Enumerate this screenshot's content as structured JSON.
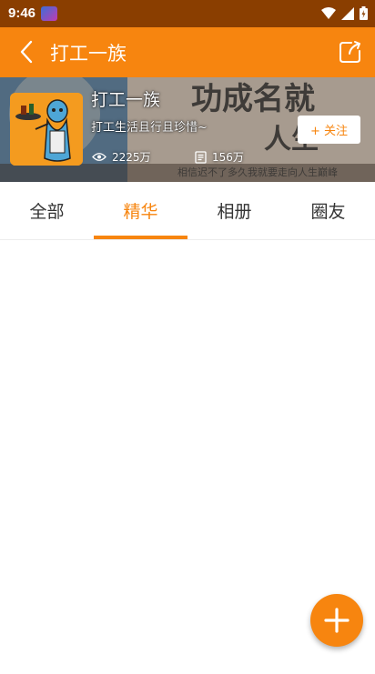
{
  "status_bar": {
    "time": "9:46"
  },
  "header": {
    "title": "打工一族"
  },
  "group": {
    "name": "打工一族",
    "description": "打工生活且行且珍惜~",
    "views": "2225万",
    "posts": "156万",
    "follow_label": "+ 关注",
    "banner_slogan_1": "功成名就",
    "banner_slogan_2": "人生",
    "banner_bottom": "相信迟不了多久我就要走向人生巅峰"
  },
  "tabs": [
    {
      "label": "全部"
    },
    {
      "label": "精华"
    },
    {
      "label": "相册"
    },
    {
      "label": "圈友"
    }
  ],
  "active_tab": "精华",
  "colors": {
    "accent": "#f7850f",
    "status_bar": "#8a3e00"
  }
}
